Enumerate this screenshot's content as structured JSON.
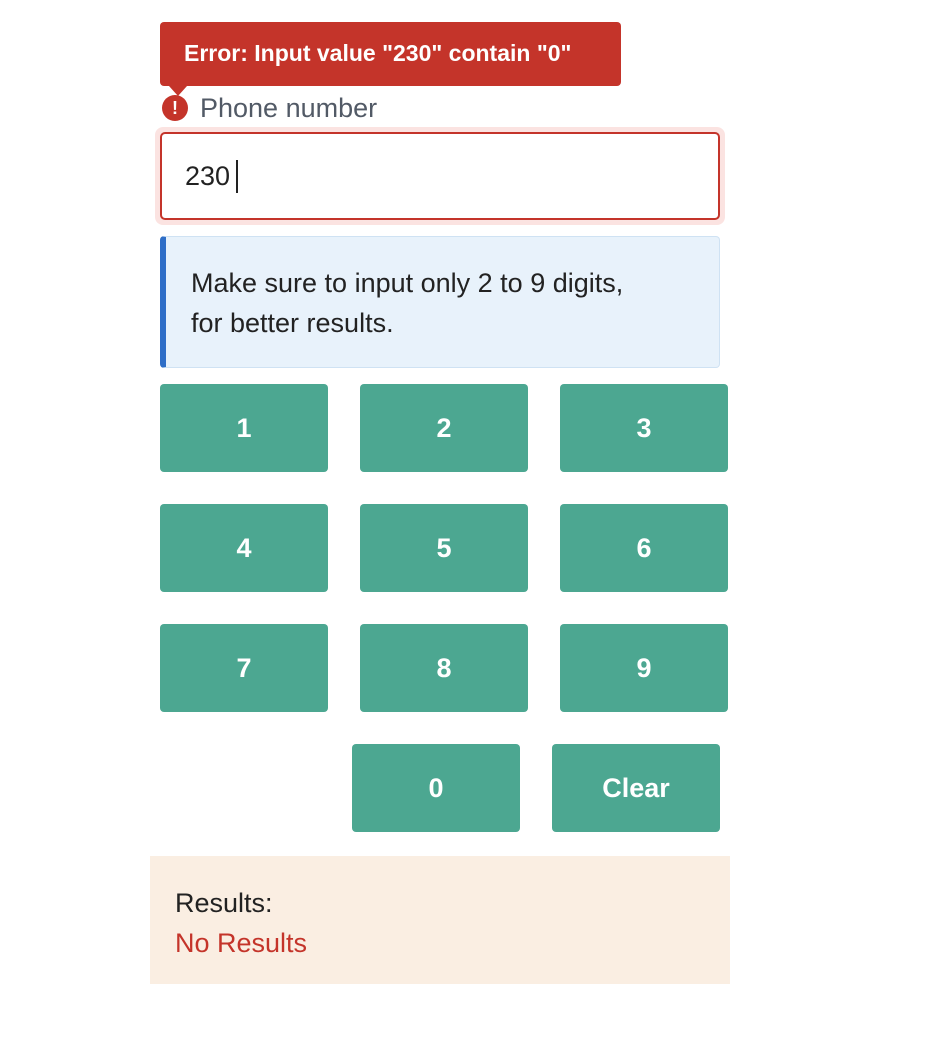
{
  "error": {
    "message": "Error: Input value \"230\" contain \"0\"",
    "icon": "!"
  },
  "field": {
    "label": "Phone number",
    "value": "230"
  },
  "info": {
    "line1": "Make sure to input only 2 to 9 digits,",
    "line2": "for better results."
  },
  "keypad": {
    "k1": "1",
    "k2": "2",
    "k3": "3",
    "k4": "4",
    "k5": "5",
    "k6": "6",
    "k7": "7",
    "k8": "8",
    "k9": "9",
    "k0": "0",
    "clear": "Clear"
  },
  "results": {
    "label": "Results:",
    "value": "No Results"
  },
  "colors": {
    "error": "#c4342a",
    "key": "#4ca791",
    "info_accent": "#2f6ec7",
    "results_bg": "#faeee2"
  }
}
